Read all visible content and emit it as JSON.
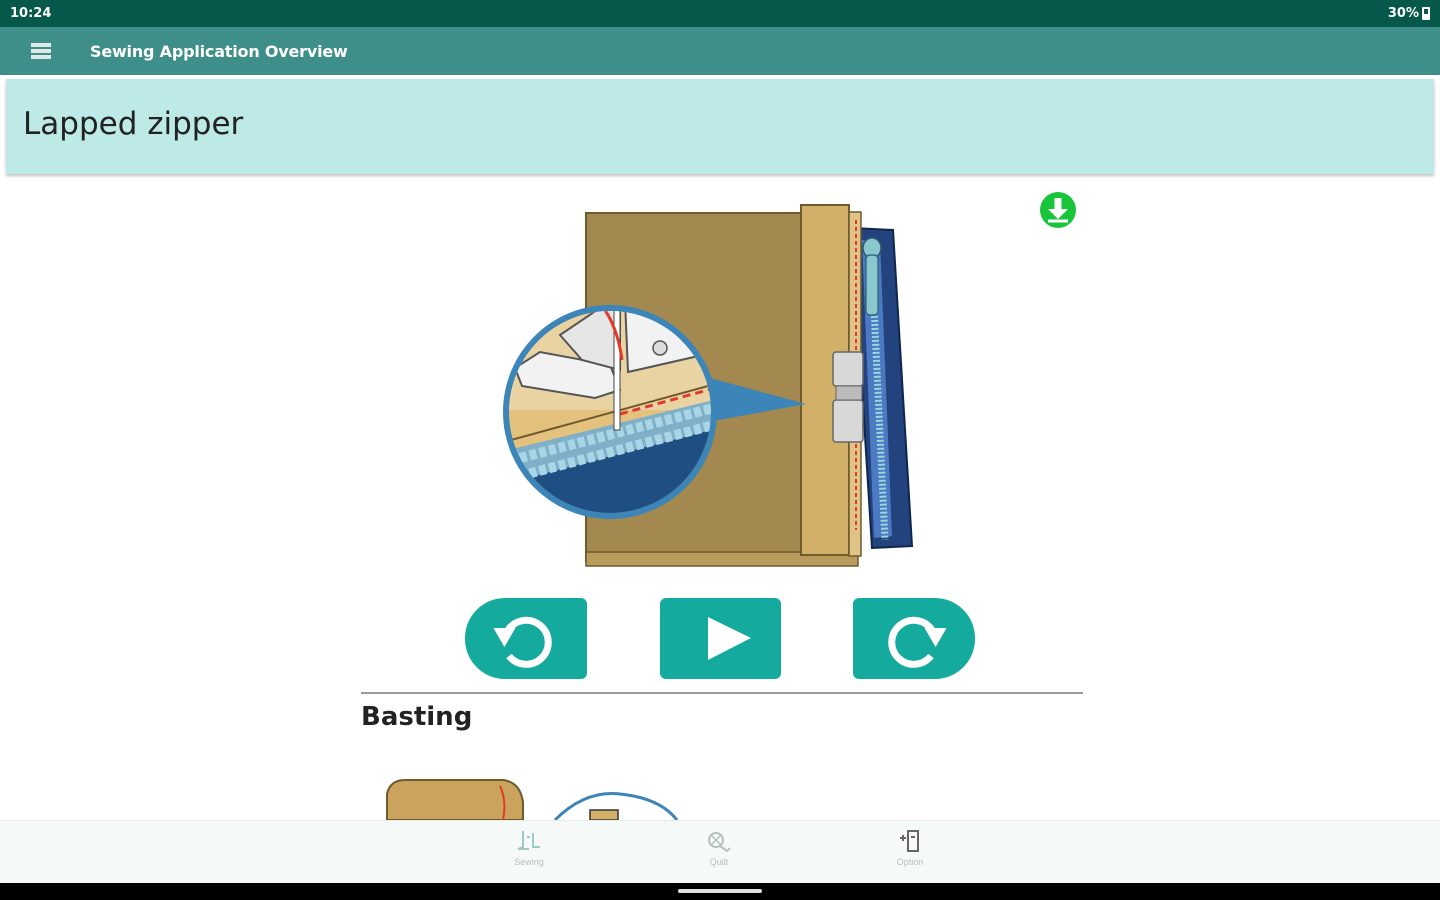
{
  "status_bar": {
    "time": "10:24",
    "battery": "30%"
  },
  "app_bar": {
    "title": "Sewing Application  Overview",
    "menu_icon": "hamburger-menu-icon"
  },
  "page": {
    "title": "Lapped zipper",
    "download_icon": "download-icon"
  },
  "playback": {
    "previous_icon": "rotate-back-icon",
    "play_icon": "play-icon",
    "next_icon": "rotate-forward-icon"
  },
  "step": {
    "title": "Basting"
  },
  "bottom_nav": [
    {
      "label": "Sewing",
      "icon": "sewing-foot-icon"
    },
    {
      "label": "Quilt",
      "icon": "quilt-icon"
    },
    {
      "label": "Option",
      "icon": "option-icon"
    }
  ],
  "colors": {
    "status_bar": "#06584a",
    "app_bar": "#3e8f89",
    "title_card": "#bde9e6",
    "button": "#15aa9e",
    "download": "#18c43a"
  }
}
